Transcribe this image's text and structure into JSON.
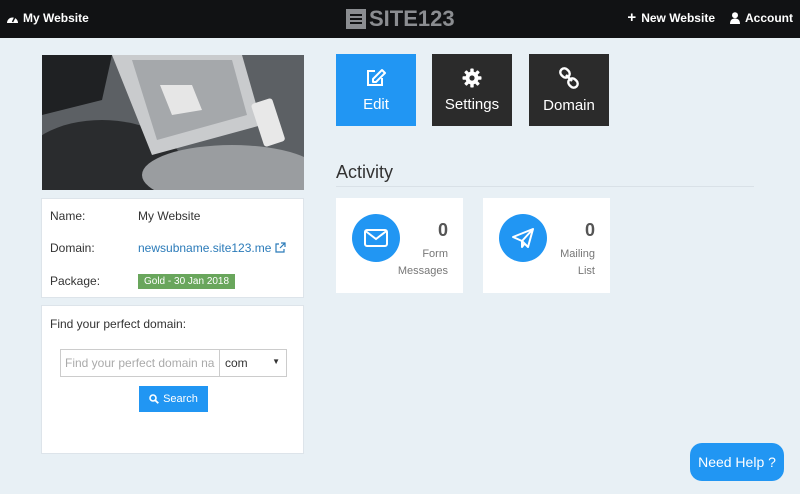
{
  "header": {
    "site_name": "My Website",
    "logo_text": "SITE123",
    "new_website_label": "New Website",
    "account_label": "Account"
  },
  "info": {
    "name_label": "Name:",
    "name_value": "My Website",
    "domain_label": "Domain:",
    "domain_value": "newsubname.site123.me",
    "package_label": "Package:",
    "package_value": "Gold - 30 Jan 2018"
  },
  "domain_search": {
    "title": "Find your perfect domain:",
    "placeholder": "Find your perfect domain name",
    "tld_selected": "com",
    "search_label": "Search"
  },
  "actions": {
    "edit_label": "Edit",
    "settings_label": "Settings",
    "domain_label": "Domain"
  },
  "activity": {
    "title": "Activity",
    "form_messages_count": "0",
    "form_messages_label_1": "Form",
    "form_messages_label_2": "Messages",
    "mailing_list_count": "0",
    "mailing_list_label_1": "Mailing",
    "mailing_list_label_2": "List"
  },
  "help": {
    "label": "Need Help ?"
  },
  "colors": {
    "accent": "#2196f3",
    "topbar": "#111214",
    "dark_tile": "#2b2b2b",
    "badge": "#69a65c",
    "background": "#e8f0f5"
  }
}
